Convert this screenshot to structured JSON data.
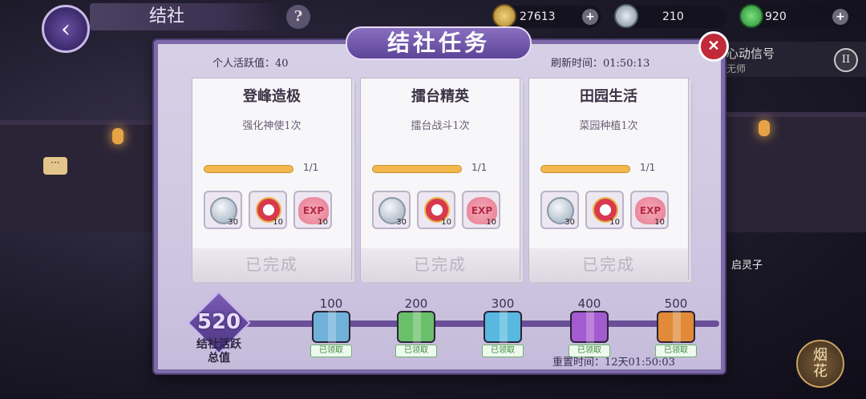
{
  "header": {
    "title": "结社",
    "help_label": "?",
    "currencies": [
      {
        "icon": "copper-coin-icon",
        "value": "27613",
        "color": "#c9a23a"
      },
      {
        "icon": "silver-coin-icon",
        "value": "210",
        "color": "#8e9aa8"
      },
      {
        "icon": "jade-icon",
        "value": "920",
        "color": "#3aa34a"
      }
    ]
  },
  "side": {
    "message_title": "心动信号",
    "message_sub": "无师",
    "pause_label": "II",
    "npc_name": "启灵子",
    "fireworks_label": "烟花"
  },
  "panel": {
    "title": "结社任务",
    "close_label": "✕",
    "activity_label": "个人活跃值：40",
    "refresh_label": "刷新时间：01:50:13",
    "tasks": [
      {
        "name": "登峰造极",
        "desc": "强化神使1次",
        "progress": "1/1",
        "status": "已完成",
        "rewards": [
          {
            "icon": "silver-coin-icon",
            "qty": "30"
          },
          {
            "icon": "medal-icon",
            "qty": "10"
          },
          {
            "icon": "exp-icon",
            "label": "EXP",
            "qty": "10"
          }
        ]
      },
      {
        "name": "擂台精英",
        "desc": "擂台战斗1次",
        "progress": "1/1",
        "status": "已完成",
        "rewards": [
          {
            "icon": "silver-coin-icon",
            "qty": "30"
          },
          {
            "icon": "medal-icon",
            "qty": "10"
          },
          {
            "icon": "exp-icon",
            "label": "EXP",
            "qty": "10"
          }
        ]
      },
      {
        "name": "田园生活",
        "desc": "菜园种植1次",
        "progress": "1/1",
        "status": "已完成",
        "rewards": [
          {
            "icon": "silver-coin-icon",
            "qty": "30"
          },
          {
            "icon": "medal-icon",
            "qty": "10"
          },
          {
            "icon": "exp-icon",
            "label": "EXP",
            "qty": "10"
          }
        ]
      }
    ],
    "total": {
      "value": "520",
      "label": "结社活跃总值"
    },
    "milestones": [
      {
        "value": "100",
        "color": "#6fb1d8",
        "claimed_label": "已领取"
      },
      {
        "value": "200",
        "color": "#6ac06a",
        "claimed_label": "已领取"
      },
      {
        "value": "300",
        "color": "#58b8e0",
        "claimed_label": "已领取"
      },
      {
        "value": "400",
        "color": "#a45ad0",
        "claimed_label": "已领取"
      },
      {
        "value": "500",
        "color": "#e08a3a",
        "claimed_label": "已领取"
      }
    ],
    "reset_label": "重置时间：12天01:50:03"
  }
}
